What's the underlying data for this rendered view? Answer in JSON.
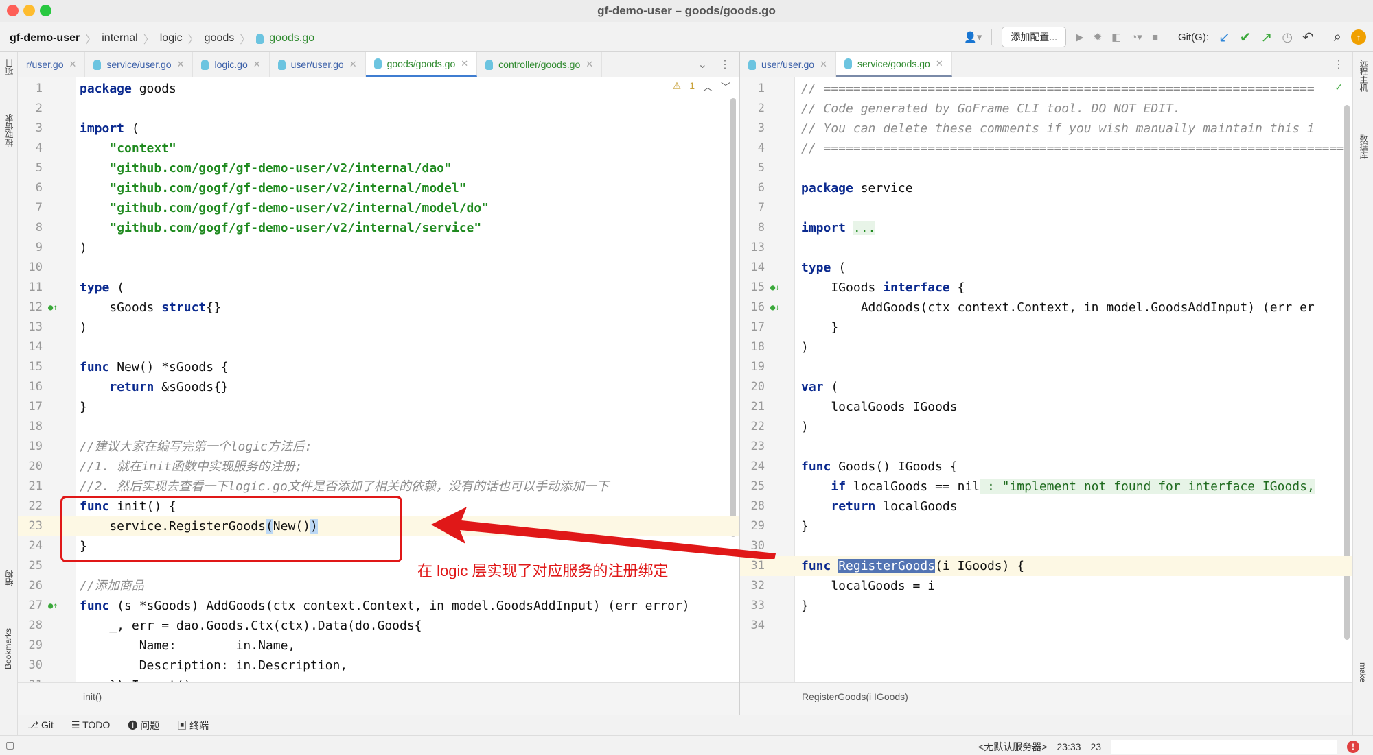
{
  "window": {
    "title": "gf-demo-user – goods/goods.go"
  },
  "breadcrumb": [
    {
      "label": "gf-demo-user"
    },
    {
      "label": "internal"
    },
    {
      "label": "logic"
    },
    {
      "label": "goods"
    },
    {
      "label": "goods.go",
      "icon": "gopher-file-icon"
    }
  ],
  "toolbar": {
    "add_config_label": "添加配置...",
    "git_label": "Git(G):"
  },
  "left_pane": {
    "tabs": [
      {
        "label": "r/user.go",
        "state": "normal"
      },
      {
        "label": "service/user.go",
        "state": "normal"
      },
      {
        "label": "logic.go",
        "state": "normal"
      },
      {
        "label": "user/user.go",
        "state": "normal"
      },
      {
        "label": "goods/goods.go",
        "state": "active"
      },
      {
        "label": "controller/goods.go",
        "state": "normal"
      }
    ],
    "warnings_count": "1",
    "breadcrumb": "init()",
    "lines": [
      {
        "n": "1",
        "code": "package goods"
      },
      {
        "n": "2",
        "code": ""
      },
      {
        "n": "3",
        "code": "import ("
      },
      {
        "n": "4",
        "code": "    \"context\""
      },
      {
        "n": "5",
        "code": "    \"github.com/gogf/gf-demo-user/v2/internal/dao\""
      },
      {
        "n": "6",
        "code": "    \"github.com/gogf/gf-demo-user/v2/internal/model\""
      },
      {
        "n": "7",
        "code": "    \"github.com/gogf/gf-demo-user/v2/internal/model/do\""
      },
      {
        "n": "8",
        "code": "    \"github.com/gogf/gf-demo-user/v2/internal/service\""
      },
      {
        "n": "9",
        "code": ")"
      },
      {
        "n": "10",
        "code": ""
      },
      {
        "n": "11",
        "code": "type ("
      },
      {
        "n": "12",
        "code": "    sGoods struct{}"
      },
      {
        "n": "13",
        "code": ")"
      },
      {
        "n": "14",
        "code": ""
      },
      {
        "n": "15",
        "code": "func New() *sGoods {"
      },
      {
        "n": "16",
        "code": "    return &sGoods{}"
      },
      {
        "n": "17",
        "code": "}"
      },
      {
        "n": "18",
        "code": ""
      },
      {
        "n": "19",
        "code": "//建议大家在编写完第一个logic方法后:"
      },
      {
        "n": "20",
        "code": "//1. 就在init函数中实现服务的注册;"
      },
      {
        "n": "21",
        "code": "//2. 然后实现去查看一下logic.go文件是否添加了相关的依赖，没有的话也可以手动添加一下"
      },
      {
        "n": "22",
        "code": "func init() {"
      },
      {
        "n": "23",
        "code": "    service.RegisterGoods(New())"
      },
      {
        "n": "24",
        "code": "}"
      },
      {
        "n": "25",
        "code": ""
      },
      {
        "n": "26",
        "code": "//添加商品"
      },
      {
        "n": "27",
        "code": "func (s *sGoods) AddGoods(ctx context.Context, in model.GoodsAddInput) (err error)"
      },
      {
        "n": "28",
        "code": "    _, err = dao.Goods.Ctx(ctx).Data(do.Goods{"
      },
      {
        "n": "29",
        "code": "        Name:        in.Name,"
      },
      {
        "n": "30",
        "code": "        Description: in.Description,"
      },
      {
        "n": "31",
        "code": "    }).Insert()"
      }
    ]
  },
  "right_pane": {
    "tabs": [
      {
        "label": "user/user.go",
        "state": "normal"
      },
      {
        "label": "service/goods.go",
        "state": "active"
      }
    ],
    "breadcrumb": "RegisterGoods(i IGoods)",
    "lines": [
      {
        "n": "1",
        "code": "// =================================================================="
      },
      {
        "n": "2",
        "code": "// Code generated by GoFrame CLI tool. DO NOT EDIT."
      },
      {
        "n": "3",
        "code": "// You can delete these comments if you wish manually maintain this i"
      },
      {
        "n": "4",
        "code": "// ======================================================================"
      },
      {
        "n": "5",
        "code": ""
      },
      {
        "n": "6",
        "code": "package service"
      },
      {
        "n": "7",
        "code": ""
      },
      {
        "n": "8",
        "code": "import ..."
      },
      {
        "n": "13",
        "code": ""
      },
      {
        "n": "14",
        "code": "type ("
      },
      {
        "n": "15",
        "code": "    IGoods interface {"
      },
      {
        "n": "16",
        "code": "        AddGoods(ctx context.Context, in model.GoodsAddInput) (err er"
      },
      {
        "n": "17",
        "code": "    }"
      },
      {
        "n": "18",
        "code": ")"
      },
      {
        "n": "19",
        "code": ""
      },
      {
        "n": "20",
        "code": "var ("
      },
      {
        "n": "21",
        "code": "    localGoods IGoods"
      },
      {
        "n": "22",
        "code": ")"
      },
      {
        "n": "23",
        "code": ""
      },
      {
        "n": "24",
        "code": "func Goods() IGoods {"
      },
      {
        "n": "25",
        "code": "    if localGoods == nil : \"implement not found for interface IGoods,"
      },
      {
        "n": "28",
        "code": "    return localGoods"
      },
      {
        "n": "29",
        "code": "}"
      },
      {
        "n": "30",
        "code": ""
      },
      {
        "n": "31",
        "code": "func RegisterGoods(i IGoods) {"
      },
      {
        "n": "32",
        "code": "    localGoods = i"
      },
      {
        "n": "33",
        "code": "}"
      },
      {
        "n": "34",
        "code": ""
      }
    ]
  },
  "left_strip": [
    "项目",
    "拉取请求",
    "结构",
    "Bookmarks"
  ],
  "right_strip": [
    "远程主机",
    "数据库",
    "make"
  ],
  "bottom_tabs": [
    {
      "label": "Git",
      "icon": "branch-icon"
    },
    {
      "label": "TODO",
      "icon": "list-icon"
    },
    {
      "label": "问题",
      "icon": "info-icon"
    },
    {
      "label": "终端",
      "icon": "terminal-icon"
    }
  ],
  "status": {
    "server": "<无默认服务器>",
    "time": "23:33",
    "extra": "23"
  },
  "annotation": {
    "text": "在 logic 层实现了对应服务的注册绑定",
    "color": "#e01818"
  }
}
